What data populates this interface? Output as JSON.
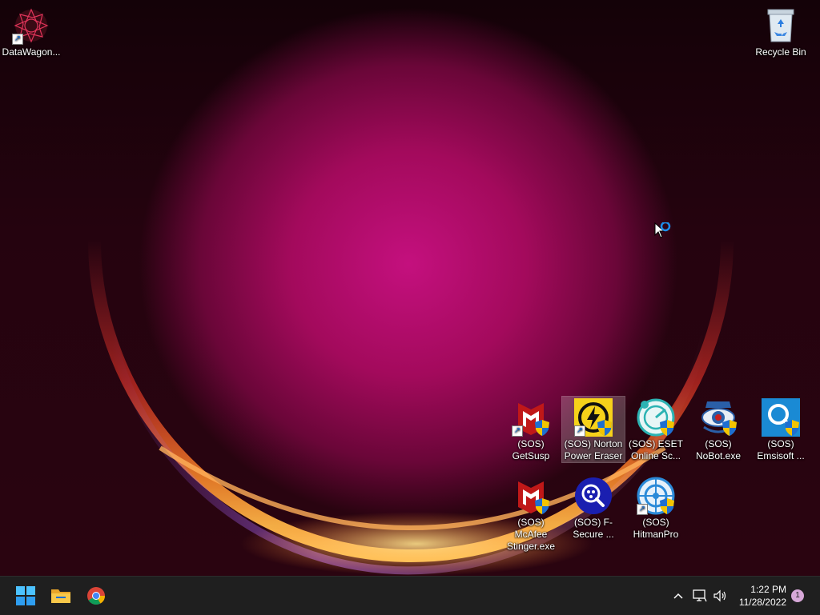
{
  "desktop": {
    "icons": [
      {
        "label": "DataWagon...",
        "icon": "datawagon-icon"
      },
      {
        "label": "Recycle Bin",
        "icon": "recycle-bin-icon"
      },
      {
        "label": "(SOS) GetSusp",
        "icon": "mcafee-icon"
      },
      {
        "label": "(SOS) Norton Power Eraser",
        "icon": "norton-power-eraser-icon"
      },
      {
        "label": "(SOS) ESET Online Sc...",
        "icon": "eset-icon"
      },
      {
        "label": "(SOS) NoBot.exe",
        "icon": "nobot-icon"
      },
      {
        "label": "(SOS) Emsisoft ...",
        "icon": "emsisoft-icon"
      },
      {
        "label": "(SOS) McAfee Stinger.exe",
        "icon": "mcafee-icon"
      },
      {
        "label": "(SOS) F-Secure ...",
        "icon": "f-secure-icon"
      },
      {
        "label": "(SOS) HitmanPro",
        "icon": "hitmanpro-icon"
      }
    ]
  },
  "taskbar": {
    "pinned": [
      {
        "name": "Start",
        "icon": "windows-start-icon"
      },
      {
        "name": "File Explorer",
        "icon": "folder-icon"
      },
      {
        "name": "Google Chrome",
        "icon": "chrome-icon"
      }
    ],
    "tray": {
      "time": "1:22 PM",
      "date": "11/28/2022",
      "notification_count": "1"
    }
  },
  "colors": {
    "taskbar": "#1f1f1f",
    "accent": "#0078d4",
    "wallpaper_core": "#c4107e"
  }
}
